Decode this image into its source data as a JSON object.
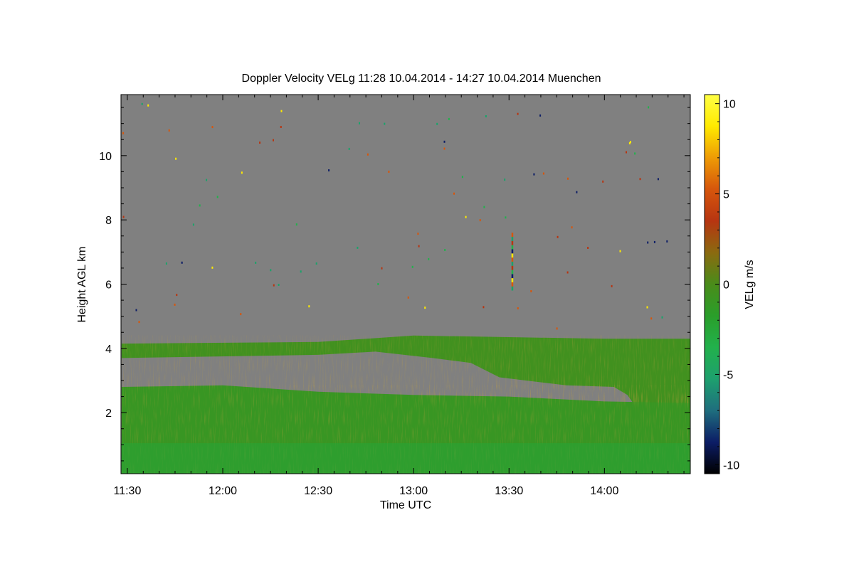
{
  "chart_data": {
    "type": "heatmap",
    "title": "Doppler Velocity VELg   11:28 10.04.2014 - 14:27 10.04.2014 Muenchen",
    "xlabel": "Time UTC",
    "ylabel": "Height AGL km",
    "x_unit": "minutes UTC",
    "xlim": [
      "11:28",
      "14:27"
    ],
    "ylim": [
      0.1,
      11.9
    ],
    "x_ticks": [
      "11:30",
      "12:00",
      "12:30",
      "13:00",
      "13:30",
      "14:00"
    ],
    "y_ticks": [
      2,
      4,
      6,
      8,
      10
    ],
    "grid": false,
    "colorbar": {
      "label": "VELg m/s",
      "range": [
        -10.5,
        10.5
      ],
      "ticks": [
        -10,
        -5,
        0,
        5,
        10
      ],
      "colors": [
        "#000000",
        "#0c1d66",
        "#1f6e7e",
        "#1ea06e",
        "#22b14c",
        "#2a9e2a",
        "#4a8c1a",
        "#8b6a10",
        "#b73511",
        "#d6560c",
        "#ee9b05",
        "#ffea00",
        "#ffff44"
      ]
    },
    "no_data_color": "#808080",
    "regions": [
      {
        "name": "upper cloud layer",
        "velocity_ms": -0.5,
        "top_km": [
          [
            11.47,
            4.15
          ],
          [
            12.5,
            4.2
          ],
          [
            13.0,
            4.4
          ],
          [
            13.5,
            4.35
          ],
          [
            14.0,
            4.3
          ],
          [
            14.45,
            4.3
          ]
        ],
        "bottom_km": [
          [
            11.47,
            3.7
          ],
          [
            12.5,
            3.8
          ],
          [
            12.8,
            3.9
          ],
          [
            13.1,
            3.7
          ],
          [
            13.3,
            3.55
          ],
          [
            13.45,
            3.1
          ],
          [
            13.8,
            2.85
          ],
          [
            14.05,
            2.8
          ],
          [
            14.12,
            2.55
          ],
          [
            14.15,
            2.3
          ],
          [
            14.45,
            2.3
          ]
        ]
      },
      {
        "name": "lower boundary layer",
        "velocity_ms": -1.0,
        "top_km": [
          [
            11.47,
            2.8
          ],
          [
            12.0,
            2.85
          ],
          [
            12.5,
            2.65
          ],
          [
            13.0,
            2.55
          ],
          [
            13.5,
            2.5
          ],
          [
            14.0,
            2.35
          ],
          [
            14.45,
            2.3
          ]
        ],
        "bottom_km": [
          [
            11.47,
            0.1
          ],
          [
            14.45,
            0.1
          ]
        ]
      }
    ],
    "spike": {
      "time": "13:31",
      "height_km": [
        5.8,
        7.6
      ]
    }
  }
}
